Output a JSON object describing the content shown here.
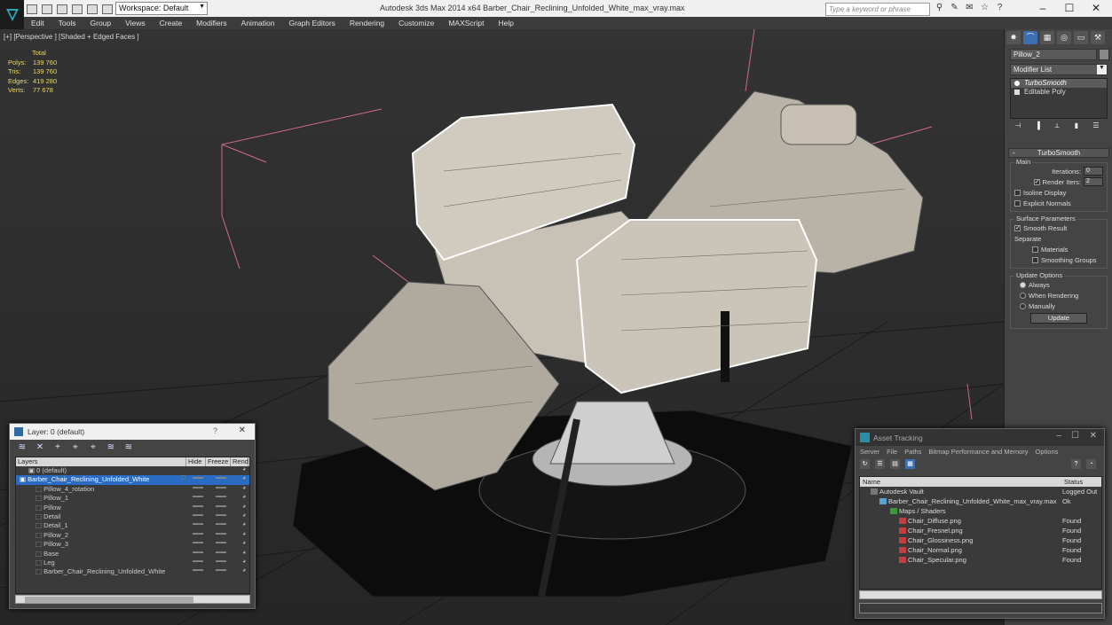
{
  "titlebar": {
    "workspace": "Workspace: Default",
    "title": "Autodesk 3ds Max 2014 x64     Barber_Chair_Reclining_Unfolded_White_max_vray.max",
    "search_placeholder": "Type a keyword or phrase"
  },
  "menu": [
    "Edit",
    "Tools",
    "Group",
    "Views",
    "Create",
    "Modifiers",
    "Animation",
    "Graph Editors",
    "Rendering",
    "Customize",
    "MAXScript",
    "Help"
  ],
  "viewport": {
    "label": "[+] [Perspective ] [Shaded + Edged Faces ]",
    "stats": {
      "header": "Total",
      "rows": [
        {
          "k": "Polys:",
          "v": "139 760"
        },
        {
          "k": "Tris:",
          "v": "139 760"
        },
        {
          "k": "Edges:",
          "v": "419 280"
        },
        {
          "k": "Verts:",
          "v": "77 678"
        }
      ]
    }
  },
  "cmdpanel": {
    "object_name": "Pillow_2",
    "modifier_list": "Modifier List",
    "stack": [
      "TurboSmooth",
      "Editable Poly"
    ],
    "turbosmooth": {
      "title": "TurboSmooth",
      "main_label": "Main",
      "iterations_label": "Iterations:",
      "iterations_value": "0",
      "render_iters_label": "Render Iters:",
      "render_iters_value": "2",
      "isoline": "Isoline Display",
      "explicit_normals": "Explicit Normals",
      "surface_params": "Surface Parameters",
      "smooth_result": "Smooth Result",
      "separate": "Separate",
      "materials": "Materials",
      "smoothing_groups": "Smoothing Groups",
      "update_options": "Update Options",
      "always": "Always",
      "when_rendering": "When Rendering",
      "manually": "Manually",
      "update_btn": "Update"
    }
  },
  "layers": {
    "title": "Layer: 0 (default)",
    "help": "?",
    "columns": [
      "Layers",
      "Hide",
      "Freeze",
      "Rend"
    ],
    "rows": [
      {
        "name": "0 (default)",
        "indent": 1
      },
      {
        "name": "Barber_Chair_Reclining_Unfolded_White",
        "indent": 1,
        "selected": true
      },
      {
        "name": "Pillow_4_rotation",
        "indent": 2
      },
      {
        "name": "Pillow_1",
        "indent": 2
      },
      {
        "name": "Pillow",
        "indent": 2
      },
      {
        "name": "Detail",
        "indent": 2
      },
      {
        "name": "Detail_1",
        "indent": 2
      },
      {
        "name": "Pillow_2",
        "indent": 2
      },
      {
        "name": "Pillow_3",
        "indent": 2
      },
      {
        "name": "Base",
        "indent": 2
      },
      {
        "name": "Leg",
        "indent": 2
      },
      {
        "name": "Barber_Chair_Reclining_Unfolded_White",
        "indent": 2
      }
    ]
  },
  "assets": {
    "title": "Asset Tracking",
    "menu": [
      "Server",
      "File",
      "Paths",
      "Bitmap Performance and Memory",
      "Options"
    ],
    "columns": [
      "Name",
      "Status"
    ],
    "rows": [
      {
        "name": "Autodesk Vault",
        "status": "Logged Out",
        "indent": 1
      },
      {
        "name": "Barber_Chair_Reclining_Unfolded_White_max_vray.max",
        "status": "Ok",
        "indent": 2
      },
      {
        "name": "Maps / Shaders",
        "status": "",
        "indent": 3
      },
      {
        "name": "Chair_Diffuse.png",
        "status": "Found",
        "indent": 4
      },
      {
        "name": "Chair_Fresnel.png",
        "status": "Found",
        "indent": 4
      },
      {
        "name": "Chair_Glossiness.png",
        "status": "Found",
        "indent": 4
      },
      {
        "name": "Chair_Normal.png",
        "status": "Found",
        "indent": 4
      },
      {
        "name": "Chair_Specular.png",
        "status": "Found",
        "indent": 4
      }
    ]
  }
}
